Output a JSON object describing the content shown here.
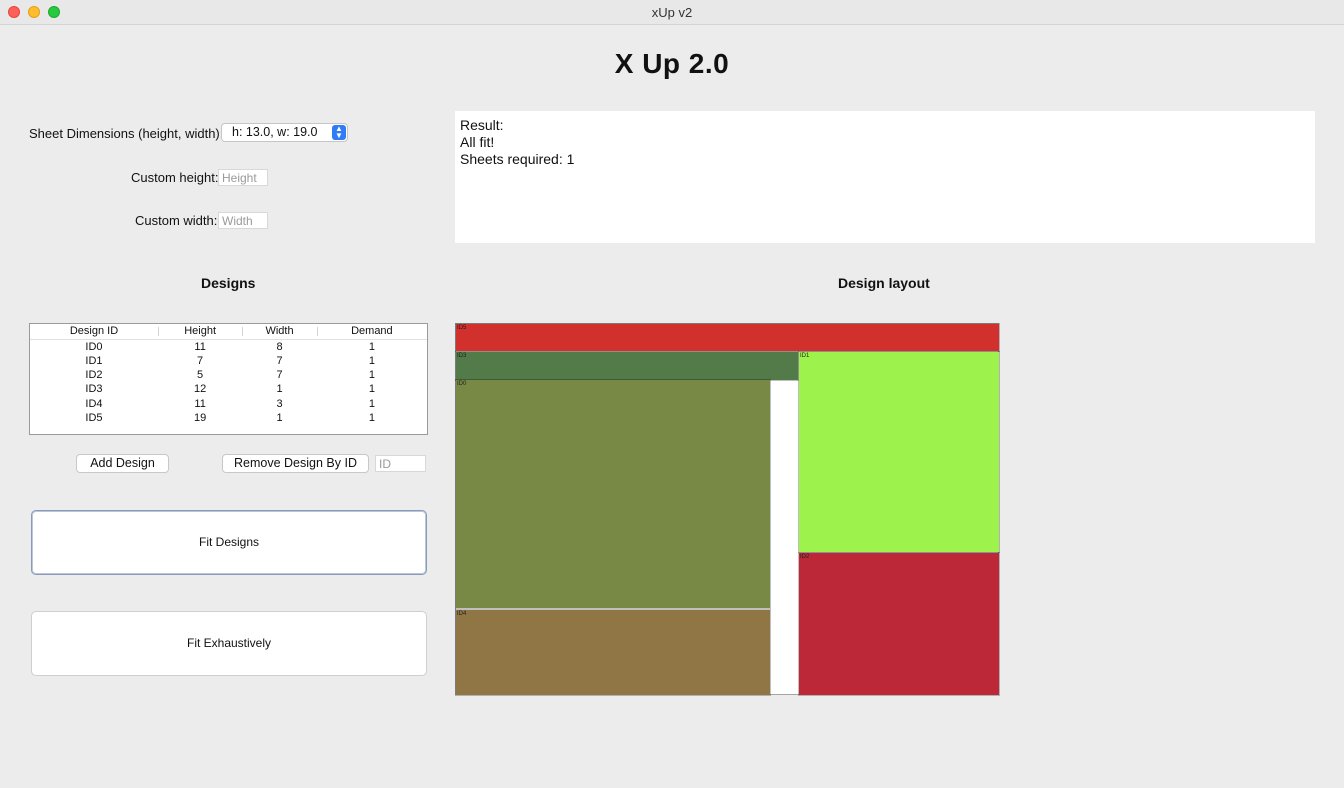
{
  "window": {
    "title": "xUp v2"
  },
  "app_title": "X Up 2.0",
  "sheet": {
    "label": "Sheet Dimensions (height, width):",
    "selected": "h: 13.0, w: 19.0",
    "custom_height_label": "Custom height:",
    "custom_height_placeholder": "Height",
    "custom_width_label": "Custom width:",
    "custom_width_placeholder": "Width"
  },
  "result": {
    "line1": "Result:",
    "line2": "All fit!",
    "line3": "Sheets required: 1"
  },
  "designs": {
    "title": "Designs",
    "columns": [
      "Design ID",
      "Height",
      "Width",
      "Demand"
    ],
    "rows": [
      [
        "ID0",
        "11",
        "8",
        "1"
      ],
      [
        "ID1",
        "7",
        "7",
        "1"
      ],
      [
        "ID2",
        "5",
        "7",
        "1"
      ],
      [
        "ID3",
        "12",
        "1",
        "1"
      ],
      [
        "ID4",
        "11",
        "3",
        "1"
      ],
      [
        "ID5",
        "19",
        "1",
        "1"
      ]
    ]
  },
  "buttons": {
    "add_design": "Add Design",
    "remove_design": "Remove Design By ID",
    "remove_id_placeholder": "ID",
    "fit_designs": "Fit Designs",
    "fit_exhaustively": "Fit Exhaustively"
  },
  "layout": {
    "title": "Design layout",
    "pieces": [
      {
        "label": "ID5",
        "color": "#d2302c"
      },
      {
        "label": "ID3",
        "color": "#537a49"
      },
      {
        "label": "ID1",
        "color": "#9ef24c"
      },
      {
        "label": "ID0",
        "color": "#788946"
      },
      {
        "label": "ID2",
        "color": "#bd2839"
      },
      {
        "label": "ID4",
        "color": "#8f7644"
      }
    ]
  }
}
